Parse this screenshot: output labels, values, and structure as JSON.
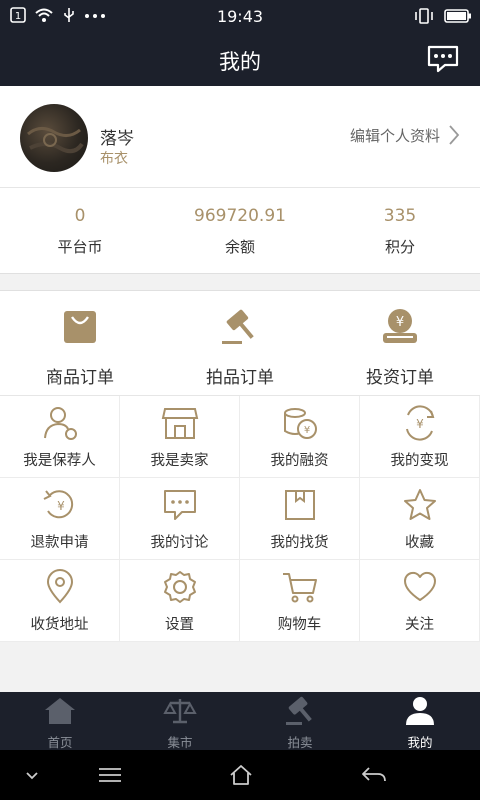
{
  "status_bar": {
    "time": "19:43"
  },
  "header": {
    "title": "我的"
  },
  "profile": {
    "name": "落岑",
    "level": "布衣",
    "edit_label": "编辑个人资料"
  },
  "stats": [
    {
      "value": "0",
      "label": "平台币"
    },
    {
      "value": "969720.91",
      "label": "余额"
    },
    {
      "value": "335",
      "label": "积分"
    }
  ],
  "orders": [
    {
      "label": "商品订单",
      "icon": "shopping-bag-icon"
    },
    {
      "label": "拍品订单",
      "icon": "auction-hammer-icon"
    },
    {
      "label": "投资订单",
      "icon": "investment-icon"
    }
  ],
  "grid": [
    {
      "label": "我是保荐人",
      "icon": "sponsor-icon"
    },
    {
      "label": "我是卖家",
      "icon": "store-icon"
    },
    {
      "label": "我的融资",
      "icon": "coins-icon"
    },
    {
      "label": "我的变现",
      "icon": "cash-out-icon"
    },
    {
      "label": "退款申请",
      "icon": "refund-icon"
    },
    {
      "label": "我的讨论",
      "icon": "chat-icon"
    },
    {
      "label": "我的找货",
      "icon": "find-goods-icon"
    },
    {
      "label": "收藏",
      "icon": "star-icon"
    },
    {
      "label": "收货地址",
      "icon": "location-icon"
    },
    {
      "label": "设置",
      "icon": "settings-gear-icon"
    },
    {
      "label": "购物车",
      "icon": "cart-icon"
    },
    {
      "label": "关注",
      "icon": "heart-icon"
    }
  ],
  "tabs": [
    {
      "label": "首页",
      "icon": "home-icon"
    },
    {
      "label": "集市",
      "icon": "scale-icon"
    },
    {
      "label": "拍卖",
      "icon": "gavel-icon"
    },
    {
      "label": "我的",
      "icon": "user-icon",
      "active": true
    }
  ],
  "colors": {
    "accent": "#a8916a",
    "dark": "#1c202b"
  }
}
